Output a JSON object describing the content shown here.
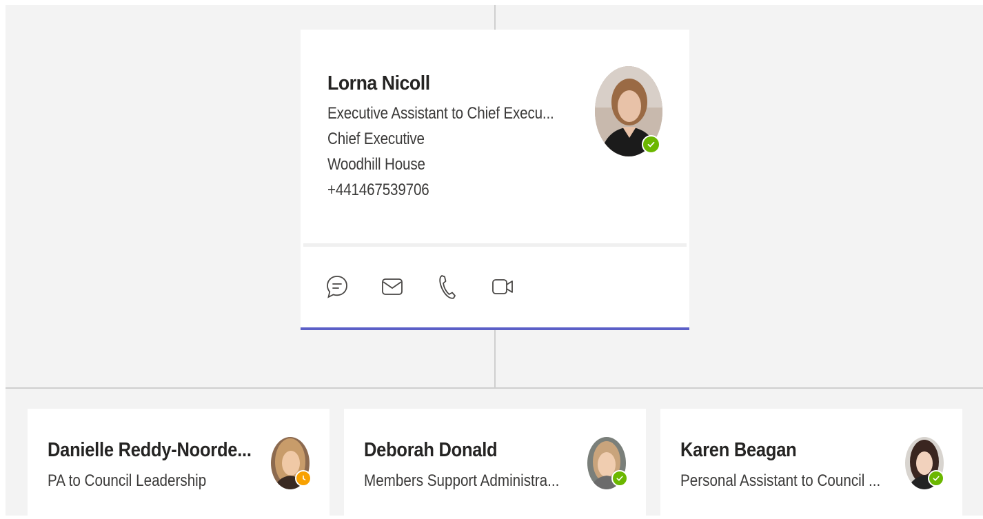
{
  "manager": {
    "name": "Lorna Nicoll",
    "title": "Executive Assistant to Chief Execu...",
    "department": "Chief Executive",
    "office": "Woodhill House",
    "phone": "+441467539706",
    "presence": "available",
    "actions": [
      {
        "icon": "chat-icon",
        "label": "Chat"
      },
      {
        "icon": "mail-icon",
        "label": "Email"
      },
      {
        "icon": "phone-icon",
        "label": "Call"
      },
      {
        "icon": "video-icon",
        "label": "Video call"
      }
    ]
  },
  "reports": [
    {
      "name": "Danielle Reddy-Noorde...",
      "title": "PA to Council Leadership",
      "presence": "away"
    },
    {
      "name": "Deborah Donald",
      "title": "Members Support Administra...",
      "presence": "available"
    },
    {
      "name": "Karen Beagan",
      "title": "Personal Assistant to Council ...",
      "presence": "available"
    }
  ],
  "colors": {
    "accent": "#5b5fc7",
    "available": "#6bb700",
    "away": "#f8a101",
    "background": "#f3f3f3",
    "connector": "#cfcfcf"
  }
}
